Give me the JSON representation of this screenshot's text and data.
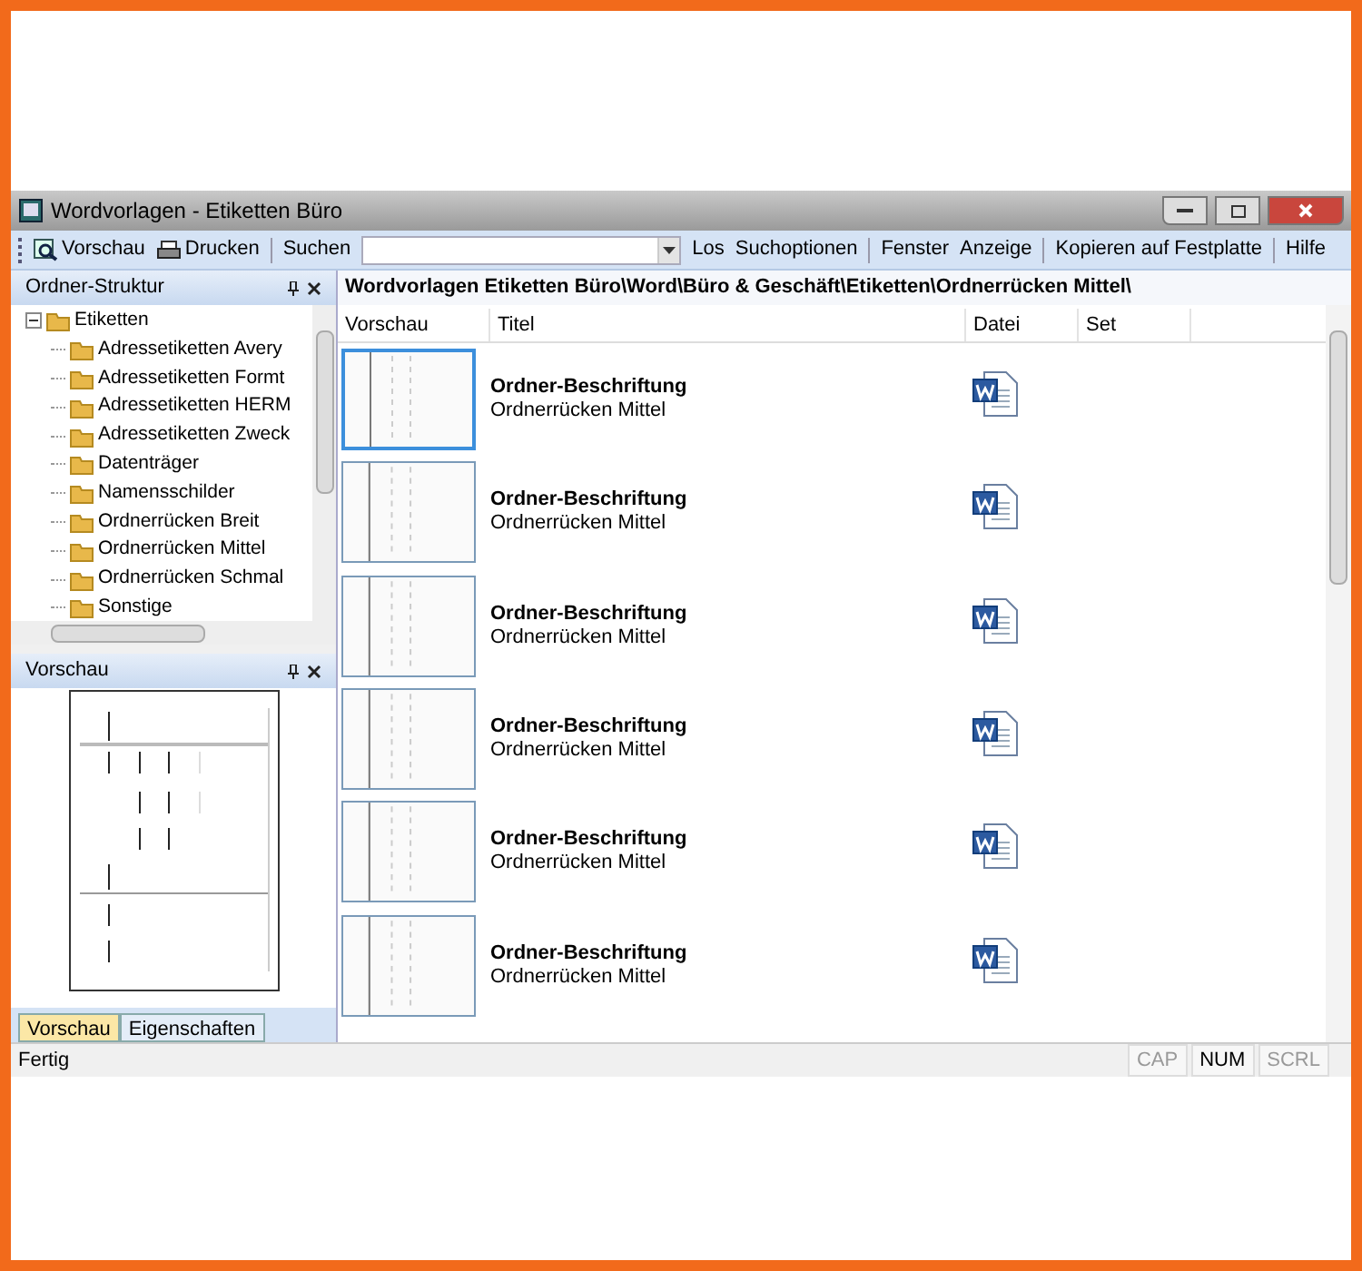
{
  "window": {
    "title": "Wordvorlagen - Etiketten Büro"
  },
  "toolbar": {
    "items": [
      {
        "kind": "preview",
        "label": "Vorschau"
      },
      {
        "kind": "print",
        "label": "Drucken"
      },
      {
        "kind": "sep"
      },
      {
        "kind": "text",
        "label": "Suchen"
      },
      {
        "kind": "search"
      },
      {
        "kind": "text",
        "label": "Los"
      },
      {
        "kind": "text",
        "label": "Suchoptionen"
      },
      {
        "kind": "sep"
      },
      {
        "kind": "text",
        "label": "Fenster"
      },
      {
        "kind": "text",
        "label": "Anzeige"
      },
      {
        "kind": "sep"
      },
      {
        "kind": "text",
        "label": "Kopieren auf Festplatte"
      },
      {
        "kind": "sep"
      },
      {
        "kind": "text",
        "label": "Hilfe"
      }
    ]
  },
  "folder_panel": {
    "title": "Ordner-Struktur",
    "tree": [
      {
        "label": "Etiketten",
        "expanded": true,
        "children": [
          {
            "label": "Adressetiketten Avery"
          },
          {
            "label": "Adressetiketten Formt"
          },
          {
            "label": "Adressetiketten HERM"
          },
          {
            "label": "Adressetiketten Zweck"
          },
          {
            "label": "Datenträger"
          },
          {
            "label": "Namensschilder"
          },
          {
            "label": "Ordnerrücken Breit"
          },
          {
            "label": "Ordnerrücken Mittel"
          },
          {
            "label": "Ordnerrücken Schmal"
          },
          {
            "label": "Sonstige"
          }
        ]
      }
    ]
  },
  "preview_panel": {
    "title": "Vorschau",
    "tabs": [
      {
        "label": "Vorschau",
        "selected": true
      },
      {
        "label": "Eigenschaften",
        "selected": false
      }
    ]
  },
  "path": "Wordvorlagen Etiketten Büro\\Word\\Büro & Geschäft\\Etiketten\\Ordnerrücken Mittel\\",
  "table": {
    "columns": [
      "Vorschau",
      "Titel",
      "Datei",
      "Set"
    ],
    "rows": [
      {
        "title": "Ordner-Beschriftung",
        "subtitle": "Ordnerrücken Mittel",
        "selected": true
      },
      {
        "title": "Ordner-Beschriftung",
        "subtitle": "Ordnerrücken Mittel",
        "selected": false
      },
      {
        "title": "Ordner-Beschriftung",
        "subtitle": "Ordnerrücken Mittel",
        "selected": false
      },
      {
        "title": "Ordner-Beschriftung",
        "subtitle": "Ordnerrücken Mittel",
        "selected": false
      },
      {
        "title": "Ordner-Beschriftung",
        "subtitle": "Ordnerrücken Mittel",
        "selected": false
      },
      {
        "title": "Ordner-Beschriftung",
        "subtitle": "Ordnerrücken Mittel",
        "selected": false
      }
    ]
  },
  "status_bar": {
    "text": "Fertig",
    "indicators": [
      {
        "label": "CAP",
        "on": false
      },
      {
        "label": "NUM",
        "on": true
      },
      {
        "label": "SCRL",
        "on": false
      }
    ]
  }
}
